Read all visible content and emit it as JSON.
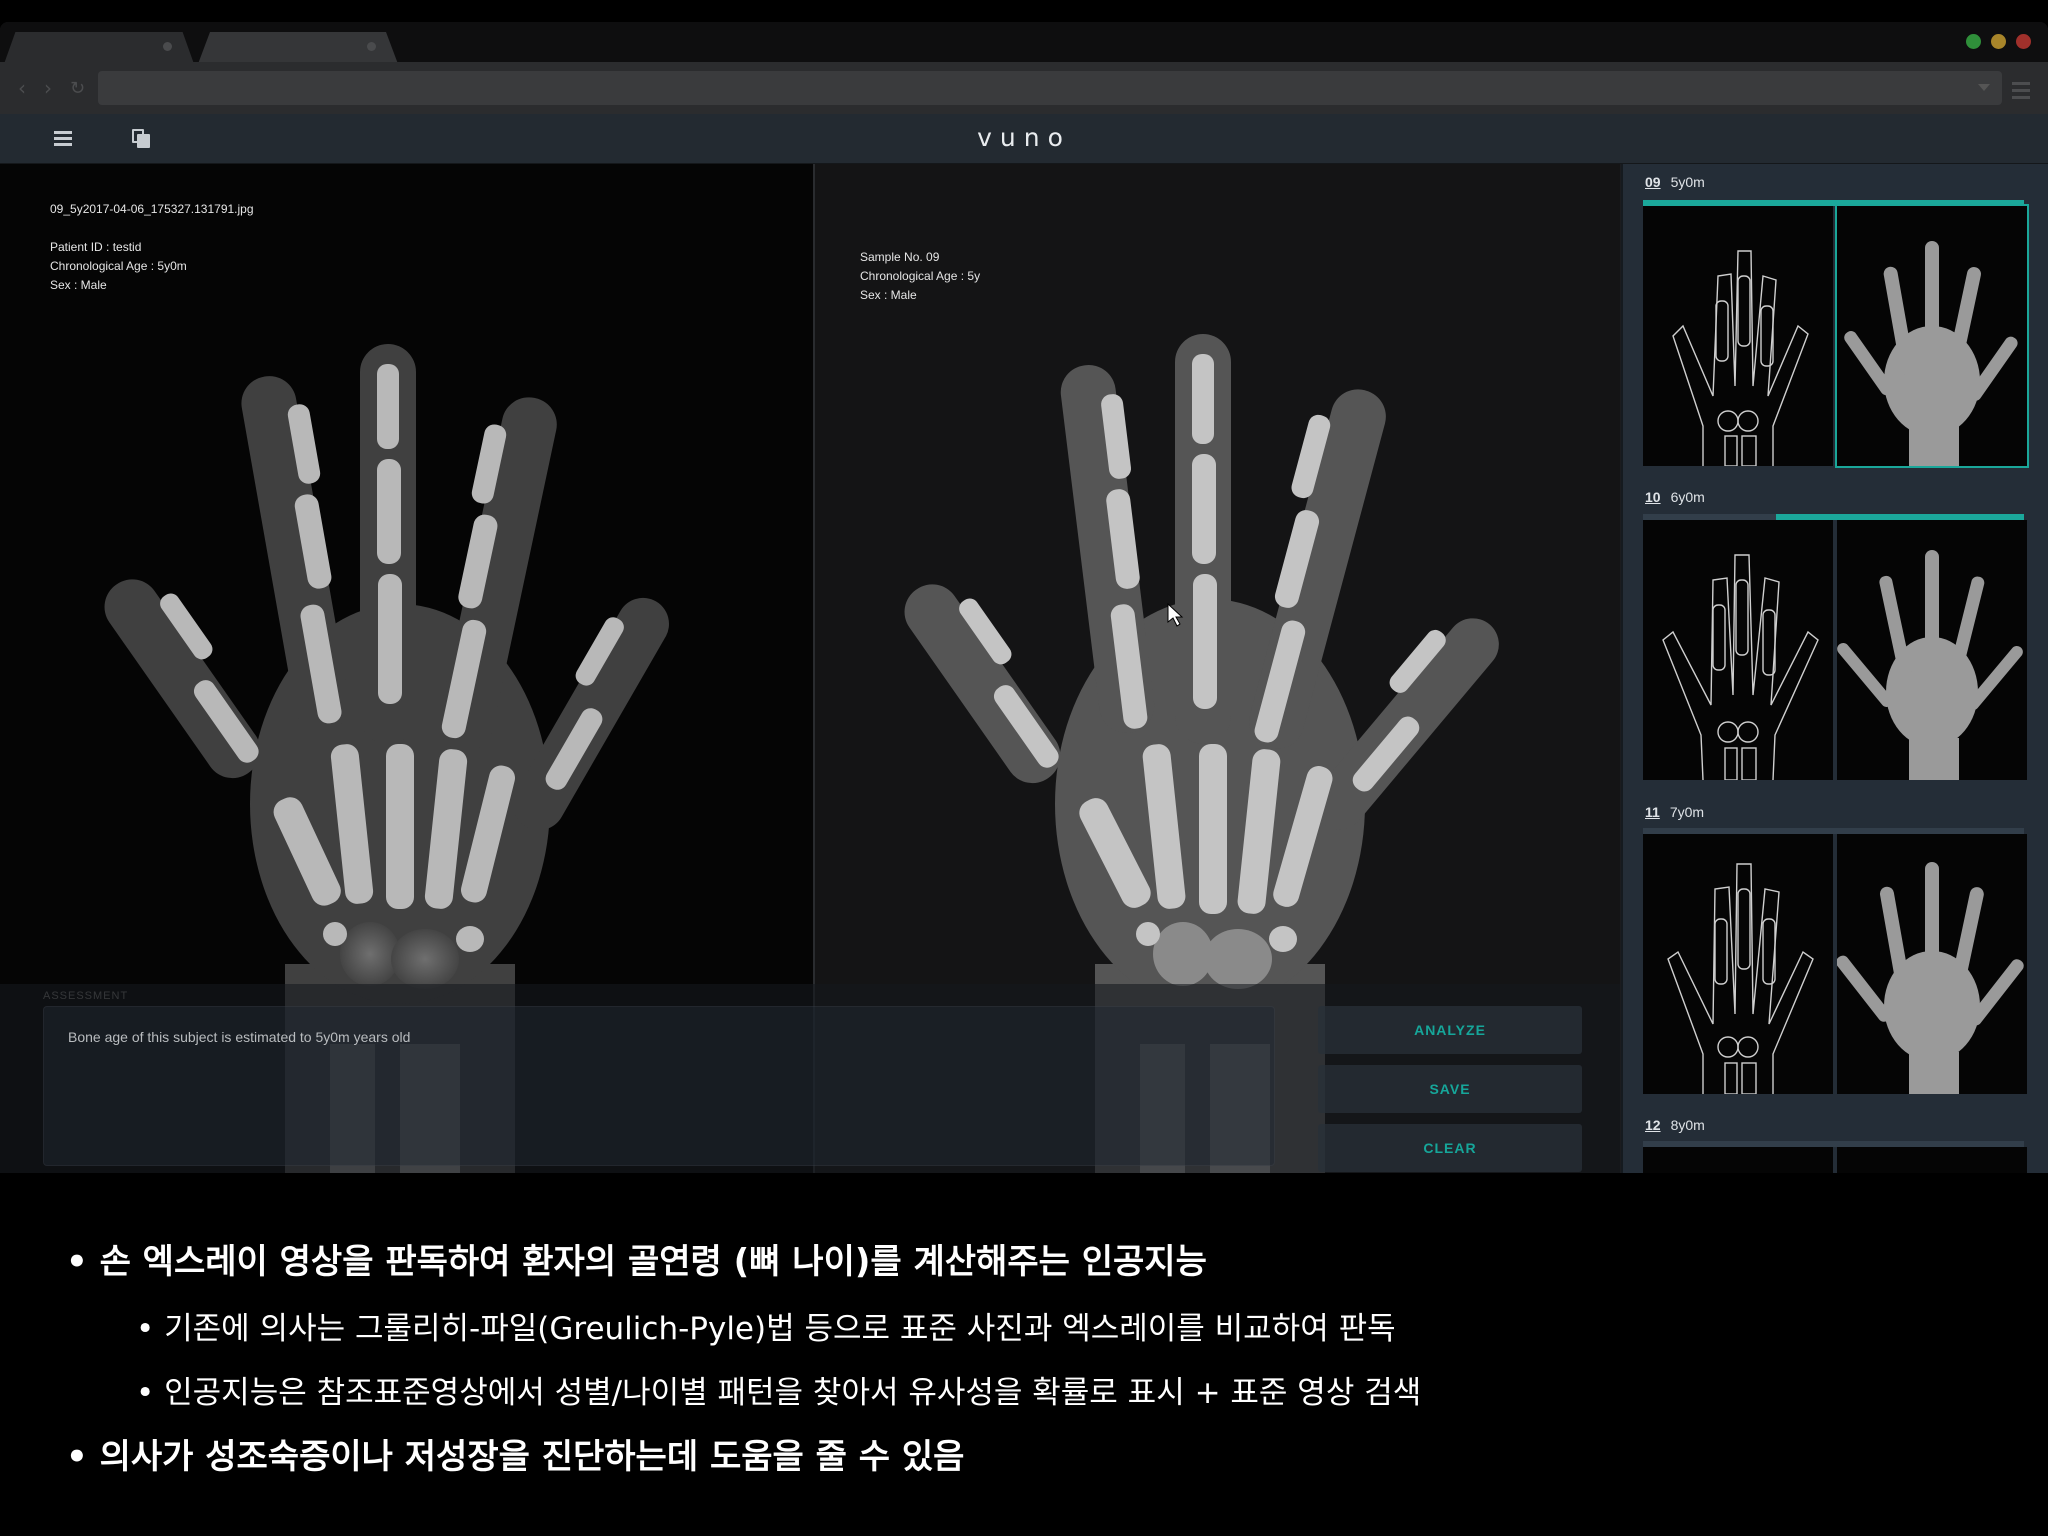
{
  "app": {
    "logo": "vuno"
  },
  "left_viewer": {
    "filename": "09_5y2017-04-06_175327.131791.jpg",
    "patient_id": "Patient ID : testid",
    "chronological_age": "Chronological Age : 5y0m",
    "sex": "Sex : Male"
  },
  "right_viewer": {
    "sample_no": "Sample No. 09",
    "chronological_age": "Chronological Age : 5y",
    "sex": "Sex : Male"
  },
  "assessment": {
    "title": "ASSESSMENT",
    "text": "Bone age of this subject is estimated to 5y0m years old",
    "buttons": {
      "analyze": "ANALYZE",
      "save": "SAVE",
      "clear": "CLEAR"
    }
  },
  "sidebar": {
    "items": [
      {
        "number": "09",
        "age": "5y0m",
        "similarity": 1.0
      },
      {
        "number": "10",
        "age": "6y0m",
        "similarity": 0.65
      },
      {
        "number": "11",
        "age": "7y0m"
      },
      {
        "number": "12",
        "age": "8y0m"
      }
    ]
  },
  "caption": {
    "bullet1": "• 손 엑스레이 영상을 판독하여 환자의 골연령 (뼈 나이)를 계산해주는 인공지능",
    "bullet1a": "• 기존에 의사는 그룰리히-파일(Greulich-Pyle)법 등으로 표준 사진과 엑스레이를 비교하여 판독",
    "bullet1b": "• 인공지능은 참조표준영상에서 성별/나이별 패턴을 찾아서 유사성을 확률로 표시 + 표준 영상 검색",
    "bullet2": "• 의사가 성조숙증이나 저성장을 진단하는데 도움을 줄 수 있음"
  },
  "colors": {
    "accent": "#1aa79a",
    "header": "#232a31",
    "sidebar": "#242d37"
  },
  "icons": [
    "hamburger-menu-icon",
    "copy-icon",
    "back-arrow-icon",
    "forward-arrow-icon",
    "reload-icon",
    "kebab-menu-icon",
    "mouse-cursor-icon"
  ]
}
